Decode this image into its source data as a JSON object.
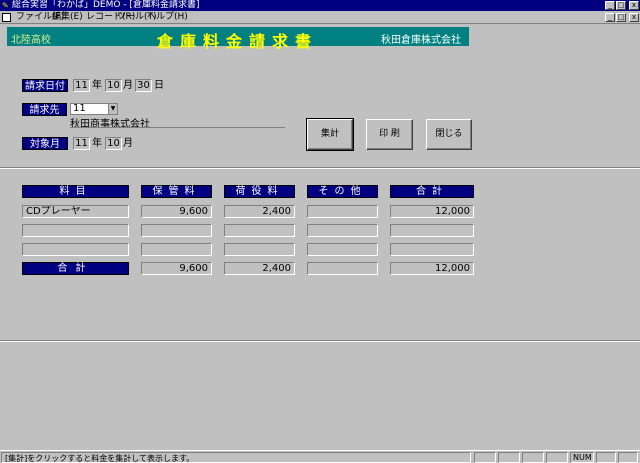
{
  "window": {
    "title": "総合実習「わかば」DEMO - [倉庫料金請求書]",
    "app_icon": "app-icon",
    "buttons": [
      "_",
      "□",
      "x"
    ]
  },
  "menu": {
    "items": [
      "ファイル(F)",
      "編集(E)",
      "レコード(R)",
      "ツール(T)",
      "ヘルプ(H)"
    ],
    "doc_buttons": [
      "_",
      "□",
      "x"
    ]
  },
  "header": {
    "school": "北陸高校",
    "title": "倉庫料金請求書",
    "company": "秋田倉庫株式会社"
  },
  "form": {
    "invoice_date_label": "請求日付",
    "invoice_date": {
      "year": "11",
      "year_unit": "年",
      "month": "10",
      "month_unit": "月",
      "day": "30",
      "day_unit": "日"
    },
    "customer_label": "請求先",
    "customer_code": "11",
    "customer_name": "秋田商事株式会社",
    "target_month_label": "対象月",
    "target": {
      "year": "11",
      "year_unit": "年",
      "month": "10",
      "month_unit": "月"
    }
  },
  "buttons": {
    "tally": "集計",
    "print": "印 刷",
    "close": "閉じる"
  },
  "table": {
    "headers": [
      "料目",
      "保管料",
      "荷役料",
      "その他",
      "合計"
    ],
    "rows": [
      [
        "CDプレーヤー",
        "9,600",
        "2,400",
        "",
        "12,000"
      ],
      [
        "",
        "",
        "",
        "",
        ""
      ],
      [
        "",
        "",
        "",
        "",
        ""
      ]
    ],
    "total_label": "合計",
    "totals": [
      "9,600",
      "2,400",
      "",
      "12,000"
    ]
  },
  "statusbar": {
    "message": "[集計]をクリックすると料金を集計して表示します。",
    "num": "NUM"
  }
}
